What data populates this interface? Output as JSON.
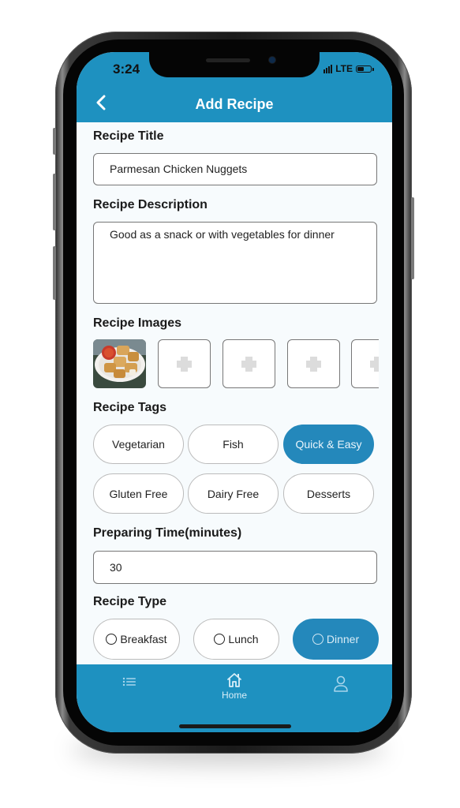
{
  "status_bar": {
    "time": "3:24",
    "network": "LTE",
    "battery_level": 0.5
  },
  "header": {
    "title": "Add Recipe",
    "back_icon": "chevron-left-icon"
  },
  "form": {
    "recipe_title": {
      "label": "Recipe Title",
      "value": "Parmesan Chicken Nuggets"
    },
    "recipe_description": {
      "label": "Recipe Description",
      "value": "Good as a snack or with vegetables for dinner"
    },
    "recipe_images": {
      "label": "Recipe Images",
      "images": [
        {
          "type": "photo",
          "description": "parmesan chicken nuggets with marinara dip"
        },
        {
          "type": "empty",
          "icon": "add-image-icon"
        },
        {
          "type": "empty",
          "icon": "add-image-icon"
        },
        {
          "type": "empty",
          "icon": "add-image-icon"
        },
        {
          "type": "empty",
          "icon": "add-image-icon"
        }
      ]
    },
    "recipe_tags": {
      "label": "Recipe Tags",
      "tags": [
        {
          "label": "Vegetarian",
          "selected": false
        },
        {
          "label": "Fish",
          "selected": false
        },
        {
          "label": "Quick & Easy",
          "selected": true
        },
        {
          "label": "Gluten Free",
          "selected": false
        },
        {
          "label": "Dairy Free",
          "selected": false
        },
        {
          "label": "Desserts",
          "selected": false
        }
      ]
    },
    "preparing_time": {
      "label": "Preparing Time(minutes)",
      "value": "30"
    },
    "recipe_type": {
      "label": "Recipe Type",
      "options": [
        {
          "label": "Breakfast",
          "selected": false
        },
        {
          "label": "Lunch",
          "selected": false
        },
        {
          "label": "Dinner",
          "selected": true
        }
      ]
    }
  },
  "tabbar": {
    "items": [
      {
        "icon": "list-icon",
        "label": ""
      },
      {
        "icon": "home-icon",
        "label": "Home"
      },
      {
        "icon": "user-icon",
        "label": ""
      }
    ]
  },
  "colors": {
    "primary": "#1e91c0",
    "selected": "#2488bb",
    "background": "#f7fbfd"
  }
}
